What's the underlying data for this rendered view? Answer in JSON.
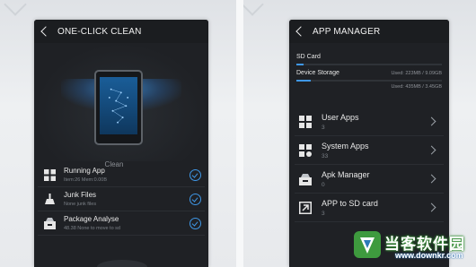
{
  "left_screen": {
    "title": "ONE-CLICK CLEAN",
    "clean_label": "Clean",
    "items": [
      {
        "title": "Running App",
        "sub": "Item:26 Mem:0.00B",
        "icon": "grid-icon"
      },
      {
        "title": "Junk Files",
        "sub": "None junk files",
        "icon": "broom-icon"
      },
      {
        "title": "Package Analyse",
        "sub": "48.38 None to move to sd",
        "icon": "package-icon"
      }
    ]
  },
  "right_screen": {
    "title": "APP MANAGER",
    "sd_card": {
      "label": "SD Card",
      "fill": 0.05
    },
    "device_storage": {
      "label": "Device Storage",
      "used": "Used: 223MB / 9.09GB",
      "fill": 0.1
    },
    "sd_used": "Used: 435MB / 3.45GB",
    "items": [
      {
        "title": "User Apps",
        "count": "3",
        "icon": "grid-icon"
      },
      {
        "title": "System Apps",
        "count": "33",
        "icon": "system-icon"
      },
      {
        "title": "Apk Manager",
        "count": "0",
        "icon": "apk-icon"
      },
      {
        "title": "APP to SD card",
        "count": "3",
        "icon": "move-to-sd-icon"
      }
    ]
  },
  "watermark": {
    "cn": "当客软件园",
    "url": "www.downkr.com"
  },
  "colors": {
    "accent": "#3f97e6",
    "screen_bg": "#1f2125"
  }
}
